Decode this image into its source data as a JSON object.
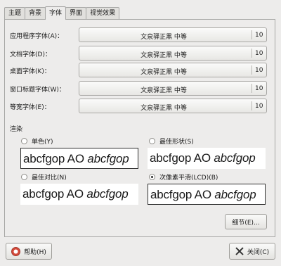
{
  "tabs": [
    {
      "label": "主题"
    },
    {
      "label": "背景"
    },
    {
      "label": "字体"
    },
    {
      "label": "界面"
    },
    {
      "label": "视觉效果"
    }
  ],
  "fonts": [
    {
      "label": "应用程序字体(A)：",
      "font": "文泉驿正黑 中等",
      "size": "10"
    },
    {
      "label": "文档字体(D)：",
      "font": "文泉驿正黑 中等",
      "size": "10"
    },
    {
      "label": "桌面字体(K)：",
      "font": "文泉驿正黑 中等",
      "size": "10"
    },
    {
      "label": "窗口标题字体(W)：",
      "font": "文泉驿正黑 中等",
      "size": "10"
    },
    {
      "label": "等宽字体(E)：",
      "font": "文泉驿正黑 中等",
      "size": "10"
    }
  ],
  "rendering": {
    "title": "渲染",
    "options": [
      {
        "label": "单色(Y)",
        "selected": false
      },
      {
        "label": "最佳形状(S)",
        "selected": false
      },
      {
        "label": "最佳对比(N)",
        "selected": false
      },
      {
        "label": "次像素平滑(LCD)(B)",
        "selected": true
      }
    ],
    "sample": {
      "regular": "abcfgop AO ",
      "italic": "abcfgop"
    }
  },
  "details_button": "细节(E)...",
  "help_button": "帮助(H)",
  "close_button": "关闭(C)"
}
